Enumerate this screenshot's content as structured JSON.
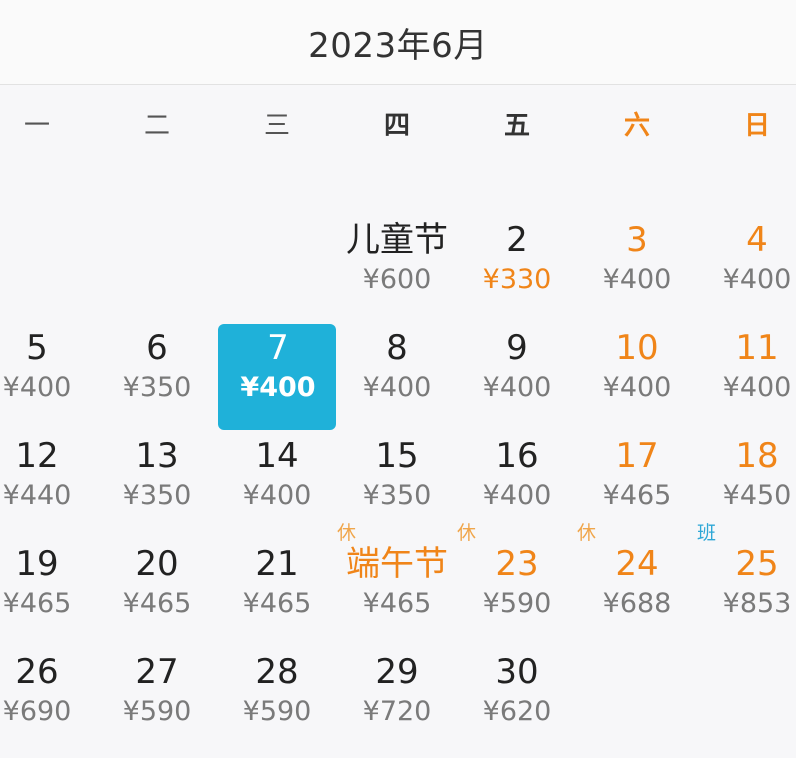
{
  "header": {
    "title": "2023年6月"
  },
  "weekdays": [
    {
      "label": "一",
      "style": "plain"
    },
    {
      "label": "二",
      "style": "plain"
    },
    {
      "label": "三",
      "style": "plain"
    },
    {
      "label": "四",
      "style": "bold"
    },
    {
      "label": "五",
      "style": "bold"
    },
    {
      "label": "六",
      "style": "weekend"
    },
    {
      "label": "日",
      "style": "weekend"
    }
  ],
  "colors": {
    "accent": "#f08519",
    "selected_bg": "#1fb1d9",
    "workday_tag": "#2ea7d6"
  },
  "weeks": [
    [
      null,
      null,
      null,
      {
        "day": "儿童节",
        "price": "¥600"
      },
      {
        "day": "2",
        "price": "¥330",
        "price_highlight": true
      },
      {
        "day": "3",
        "price": "¥400",
        "weekend": true
      },
      {
        "day": "4",
        "price": "¥400",
        "weekend": true
      }
    ],
    [
      {
        "day": "5",
        "price": "¥400"
      },
      {
        "day": "6",
        "price": "¥350"
      },
      {
        "day": "7",
        "price": "¥400",
        "selected": true
      },
      {
        "day": "8",
        "price": "¥400"
      },
      {
        "day": "9",
        "price": "¥400"
      },
      {
        "day": "10",
        "price": "¥400",
        "weekend": true
      },
      {
        "day": "11",
        "price": "¥400",
        "weekend": true
      }
    ],
    [
      {
        "day": "12",
        "price": "¥440"
      },
      {
        "day": "13",
        "price": "¥350"
      },
      {
        "day": "14",
        "price": "¥400"
      },
      {
        "day": "15",
        "price": "¥350"
      },
      {
        "day": "16",
        "price": "¥400"
      },
      {
        "day": "17",
        "price": "¥465",
        "weekend": true
      },
      {
        "day": "18",
        "price": "¥450",
        "weekend": true
      }
    ],
    [
      {
        "day": "19",
        "price": "¥465"
      },
      {
        "day": "20",
        "price": "¥465"
      },
      {
        "day": "21",
        "price": "¥465"
      },
      {
        "day": "端午节",
        "price": "¥465",
        "holiday": true,
        "tag": "休"
      },
      {
        "day": "23",
        "price": "¥590",
        "holiday": true,
        "tag": "休"
      },
      {
        "day": "24",
        "price": "¥688",
        "weekend": true,
        "tag": "休"
      },
      {
        "day": "25",
        "price": "¥853",
        "weekend": true,
        "tag": "班",
        "tag_type": "workday"
      }
    ],
    [
      {
        "day": "26",
        "price": "¥690"
      },
      {
        "day": "27",
        "price": "¥590"
      },
      {
        "day": "28",
        "price": "¥590"
      },
      {
        "day": "29",
        "price": "¥720"
      },
      {
        "day": "30",
        "price": "¥620"
      },
      null,
      null
    ]
  ]
}
